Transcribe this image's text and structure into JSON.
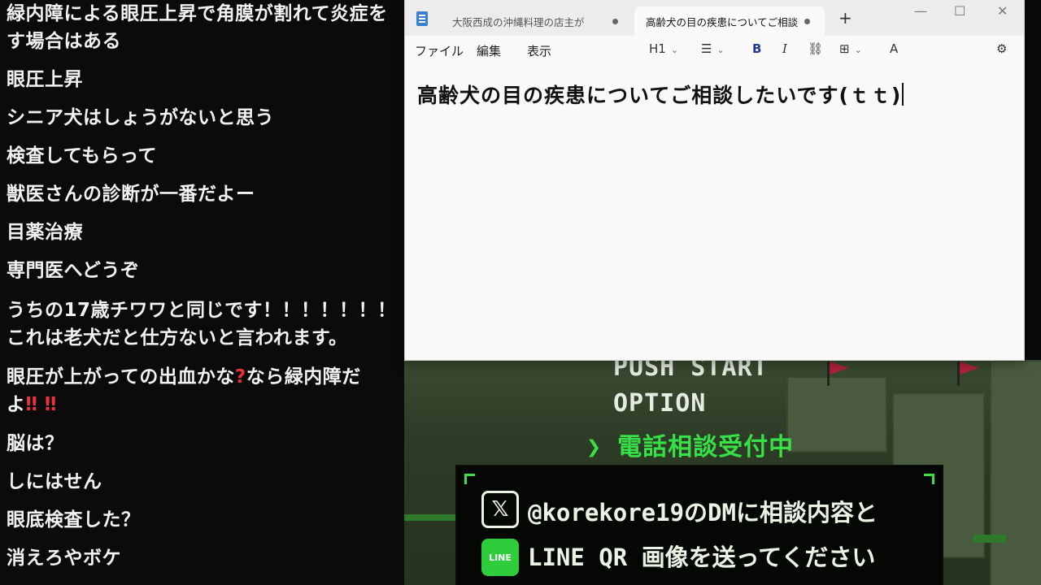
{
  "chat": {
    "messages": [
      {
        "text": "緑内障による眼圧上昇で角膜が割れて炎症を\nす場合はある"
      },
      {
        "text": "眼圧上昇"
      },
      {
        "text": "シニア犬はしょうがないと思う"
      },
      {
        "text": "検査してもらって"
      },
      {
        "text": "獣医さんの診断が一番だよー"
      },
      {
        "text": "目薬治療"
      },
      {
        "text": "専門医へどうぞ"
      },
      {
        "text": "うちの17歳チワワと同じです！！！！！！！\nこれは老犬だと仕方ないと言われます。"
      },
      {
        "text_a": "眼圧が上がっての出血かな",
        "q": "?",
        "text_b": "なら緑内障だ",
        "text_c": "よ",
        "bangs": "‼ ‼"
      },
      {
        "text": "脳は？"
      },
      {
        "text": "しにはせん"
      },
      {
        "text": "眼底検査した？"
      },
      {
        "text": "消えろやボケ"
      }
    ]
  },
  "notepad": {
    "tabs": [
      {
        "label": "大阪西成の沖縄料理の店主が"
      },
      {
        "label": "高齢犬の目の疾患についてご相談"
      }
    ],
    "new_tab": "+",
    "window_controls": {
      "minimize": "—",
      "maximize": "☐",
      "close": "✕"
    },
    "menus": [
      "ファイル",
      "編集",
      "表示"
    ],
    "toolbar": {
      "heading": "H1",
      "list": "☰",
      "bold": "B",
      "italic": "I",
      "link": "⛓",
      "table": "⊞",
      "spell": "A",
      "settings": "⚙"
    },
    "document_text": "高齢犬の目の疾患についてご相談したいです(ｔｔ)"
  },
  "game": {
    "menu": [
      "PUSH START",
      "OPTION"
    ],
    "selected_prefix": "❯",
    "selected": "電話相談受付中",
    "dialog": {
      "x_icon": "𝕏",
      "line1": "@korekore19のDMに相談内容と",
      "line_icon": "LINE",
      "line2": "LINE QR 画像を送ってください"
    }
  },
  "colors": {
    "accent_green": "#3ee04a",
    "alert_red": "#e8333f"
  }
}
